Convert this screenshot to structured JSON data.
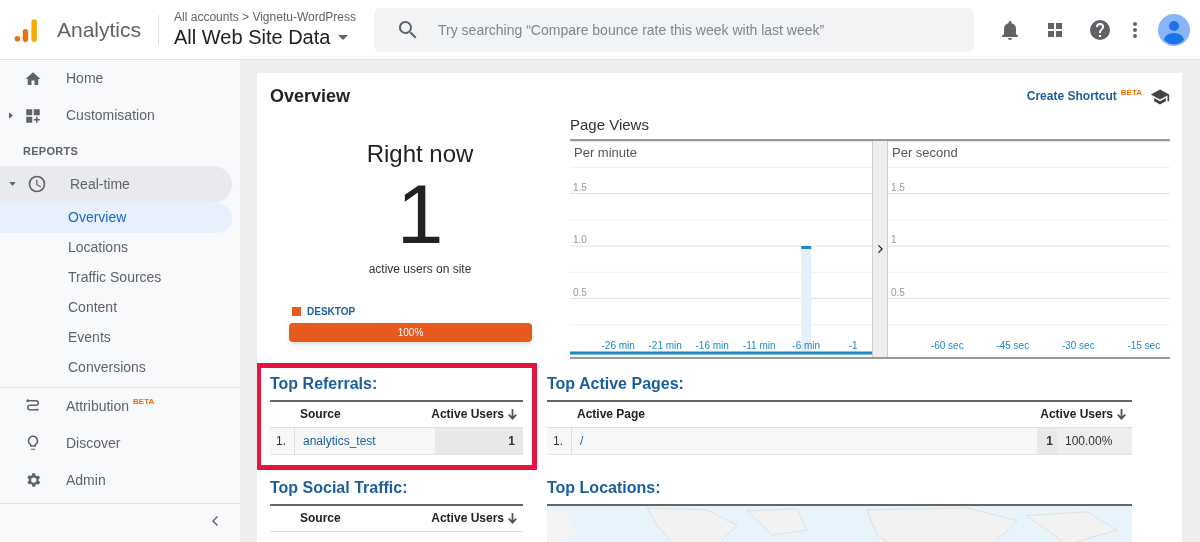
{
  "header": {
    "product": "Analytics",
    "breadcrumb": "All accounts > Vignetu-WordPress",
    "property": "All Web Site Data",
    "search": {
      "placeholder": "Try searching “Compare bounce rate this week with last week”"
    }
  },
  "sidebar": {
    "items": [
      {
        "label": "Home"
      },
      {
        "label": "Customisation",
        "expanded": false
      }
    ],
    "section": "REPORTS",
    "realtime": {
      "label": "Real-time",
      "selected": true,
      "expanded": true,
      "children": [
        {
          "label": "Overview",
          "selected": true
        },
        {
          "label": "Locations",
          "selected": false
        },
        {
          "label": "Traffic Sources",
          "selected": false
        },
        {
          "label": "Content",
          "selected": false
        },
        {
          "label": "Events",
          "selected": false
        },
        {
          "label": "Conversions",
          "selected": false
        }
      ]
    },
    "bottom": [
      {
        "label": "Attribution",
        "badge": "BETA"
      },
      {
        "label": "Discover"
      },
      {
        "label": "Admin"
      }
    ]
  },
  "overview": {
    "title": "Overview",
    "shortcut": "Create Shortcut",
    "shortcut_badge": "BETA",
    "right_now": {
      "title": "Right now",
      "count": "1",
      "caption": "active users on site",
      "legend": "DESKTOP",
      "level": 1,
      "reading": "100%"
    },
    "page_views": {
      "title": "Page Views",
      "per_minute": {
        "label": "Per minute",
        "chart_data": {
          "type": "bar",
          "grid": true,
          "ylim": [
            0,
            2
          ],
          "categories": [
            "-26 min",
            "-21 min",
            "-16 min",
            "-11 min",
            "-6 min",
            "-1"
          ],
          "values": [
            0,
            0,
            0,
            0,
            1,
            0
          ],
          "yticks": [
            {
              "value": 0.5,
              "label": "0.5"
            },
            {
              "value": 1,
              "label": "1.0"
            },
            {
              "value": 1.5,
              "label": "1.5"
            }
          ]
        }
      },
      "per_second": {
        "label": "Per second",
        "chart_data": {
          "type": "bar",
          "grid": true,
          "ylim": [
            0,
            2
          ],
          "categories": [
            "-60 sec",
            "-45 sec",
            "-30 sec",
            "-15 sec"
          ],
          "values": [
            0,
            0,
            0,
            0
          ],
          "yticks": [
            {
              "value": 0.5,
              "label": "0.5"
            },
            {
              "value": 1,
              "label": "1"
            },
            {
              "value": 1.5,
              "label": "1.5"
            }
          ]
        }
      }
    },
    "top_referrals": {
      "title": "Top Referrals:",
      "columns": [
        "Source",
        "Active Users"
      ],
      "rows": [
        {
          "index": "1.",
          "source": "analytics_test",
          "users": "1"
        }
      ]
    },
    "top_active_pages": {
      "title": "Top Active Pages:",
      "columns": [
        "Active Page",
        "Active Users"
      ],
      "rows": [
        {
          "index": "1.",
          "page": "/",
          "users": "1",
          "share": "100.00%"
        }
      ]
    },
    "top_social": {
      "title": "Top Social Traffic:",
      "columns": [
        "Source",
        "Active Users"
      ]
    },
    "top_locations": {
      "title": "Top Locations:"
    }
  }
}
